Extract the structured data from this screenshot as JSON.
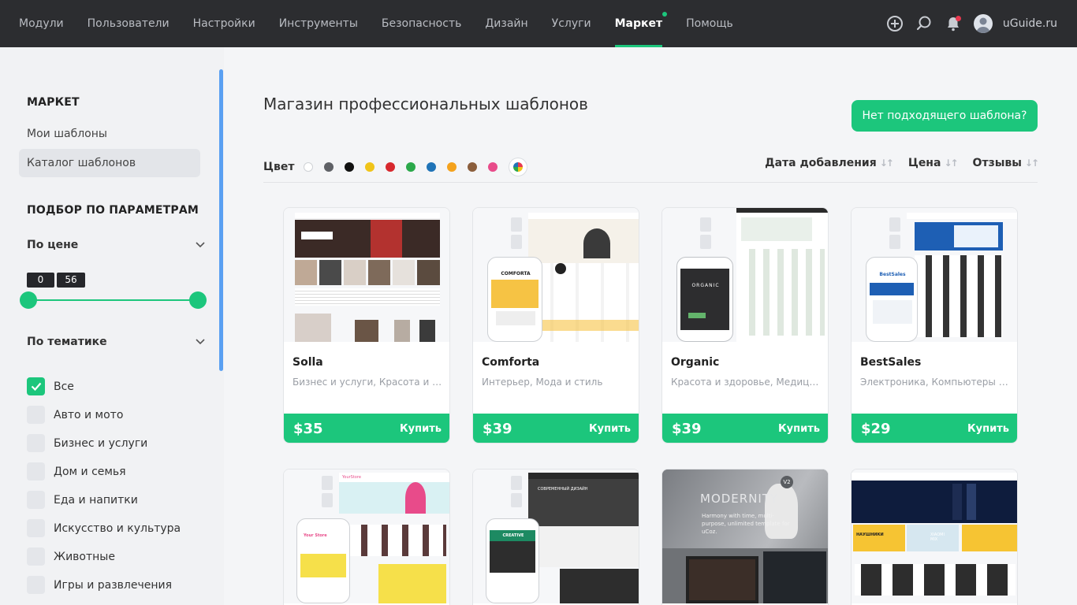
{
  "nav": {
    "items": [
      "Модули",
      "Пользователи",
      "Настройки",
      "Инструменты",
      "Безопасность",
      "Дизайн",
      "Услуги",
      "Маркет",
      "Помощь"
    ],
    "active": "Маркет",
    "username": "uGuide.ru"
  },
  "sidebar": {
    "section_title": "МАРКЕТ",
    "links": [
      "Мои шаблоны",
      "Каталог шаблонов"
    ],
    "active_link": "Каталог шаблонов",
    "filters_title": "ПОДБОР ПО ПАРАМЕТРАМ",
    "price_filter": {
      "label": "По цене",
      "min": "0",
      "max": "56"
    },
    "topic_filter": {
      "label": "По тематике",
      "options": [
        {
          "label": "Все",
          "checked": true
        },
        {
          "label": "Авто и мото",
          "checked": false
        },
        {
          "label": "Бизнес и услуги",
          "checked": false
        },
        {
          "label": "Дом и семья",
          "checked": false
        },
        {
          "label": "Еда и напитки",
          "checked": false
        },
        {
          "label": "Искусство и культура",
          "checked": false
        },
        {
          "label": "Животные",
          "checked": false
        },
        {
          "label": "Игры и развлечения",
          "checked": false
        }
      ]
    }
  },
  "main": {
    "title": "Магазин профессиональных шаблонов",
    "cta": "Нет подходящего шаблона?",
    "color_label": "Цвет",
    "colors": [
      "#ffffff",
      "#5f6166",
      "#111111",
      "#f0c419",
      "#d7282e",
      "#2ba84a",
      "#1f73b7",
      "#f4a21d",
      "#8b5e3c",
      "#e84b8a"
    ],
    "sort": [
      "Дата добавления",
      "Цена",
      "Отзывы"
    ],
    "cards": [
      {
        "name": "Solla",
        "tags": "Бизнес и услуги, Красота и здоровье",
        "price": "$35",
        "buy": "Купить"
      },
      {
        "name": "Comforta",
        "tags": "Интерьер, Мода и стиль",
        "price": "$39",
        "buy": "Купить"
      },
      {
        "name": "Organic",
        "tags": "Красота и здоровье, Медицина",
        "price": "$39",
        "buy": "Купить"
      },
      {
        "name": "BestSales",
        "tags": "Электроника, Компьютеры и техника",
        "price": "$29",
        "buy": "Купить"
      }
    ],
    "row2": [
      {
        "thumb_text": "YourStore",
        "phone_text": "Your Store"
      },
      {
        "thumb_text": "СОВРЕМЕННЫЙ ДИЗАЙН",
        "phone_text": "CREATIVE"
      },
      {
        "thumb_text": "MODERNITY",
        "thumb_sub": "Harmony with time, multi-purpose, unlimited template for uCoz.",
        "badge": "V2"
      },
      {
        "thumb_text": "НАУШНИКИ",
        "thumb_sub": "XIAOMI MIX"
      }
    ],
    "thumb_labels": {
      "comforta_phone": "COMFORTA",
      "organic_phone": "ORGANIC",
      "bestsales_phone": "BestSales"
    }
  }
}
